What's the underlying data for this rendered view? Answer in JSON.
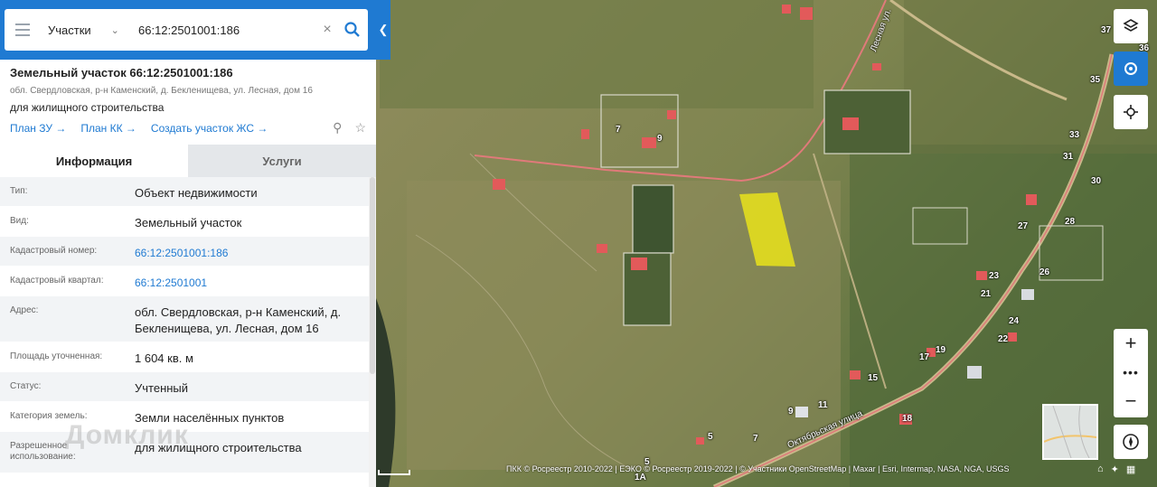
{
  "search": {
    "layer": "Участки",
    "query": "66:12:2501001:186"
  },
  "parcel": {
    "title": "Земельный участок 66:12:2501001:186",
    "address": "обл. Свердловская, р-н Каменский, д. Бекленищева, ул. Лесная, дом 16",
    "use": "для жилищного строительства",
    "links": [
      "План ЗУ →",
      "План КК →",
      "Создать участок ЖС →"
    ]
  },
  "tabs": [
    "Информация",
    "Услуги"
  ],
  "props": [
    {
      "k": "Тип:",
      "v": "Объект недвижимости"
    },
    {
      "k": "Вид:",
      "v": "Земельный участок"
    },
    {
      "k": "Кадастровый номер:",
      "v": "66:12:2501001:186"
    },
    {
      "k": "Кадастровый квартал:",
      "v": "66:12:2501001"
    },
    {
      "k": "Адрес:",
      "v": "обл. Свердловская, р-н Каменский, д. Бекленищева, ул. Лесная, дом 16"
    },
    {
      "k": "Площадь уточненная:",
      "v": "1 604 кв. м"
    },
    {
      "k": "Статус:",
      "v": "Учтенный"
    },
    {
      "k": "Категория земель:",
      "v": "Земли населённых пунктов"
    },
    {
      "k": "Разрешенное использование:",
      "v": "для жилищного строительства"
    }
  ],
  "watermark": "Домклик",
  "map": {
    "street_labels": [
      "Лесная ул.",
      "Октябрьская улица"
    ],
    "house_numbers": [
      "7",
      "9",
      "5",
      "11",
      "15",
      "17",
      "19",
      "21",
      "22",
      "23",
      "24",
      "26",
      "27",
      "28",
      "30",
      "31",
      "33",
      "35",
      "37",
      "36",
      "9",
      "7",
      "5",
      "18",
      "1А"
    ],
    "selected_parcel_color": "#e9e31b",
    "road_color": "#e07a7a"
  },
  "attribution": "ПКК © Росреестр 2010-2022 | ЕЭКО © Росреестр 2019-2022 | © Участники OpenStreetMap | Maxar | Esri, Intermap, NASA, NGA, USGS",
  "colors": {
    "accent": "#1f7ad2"
  }
}
